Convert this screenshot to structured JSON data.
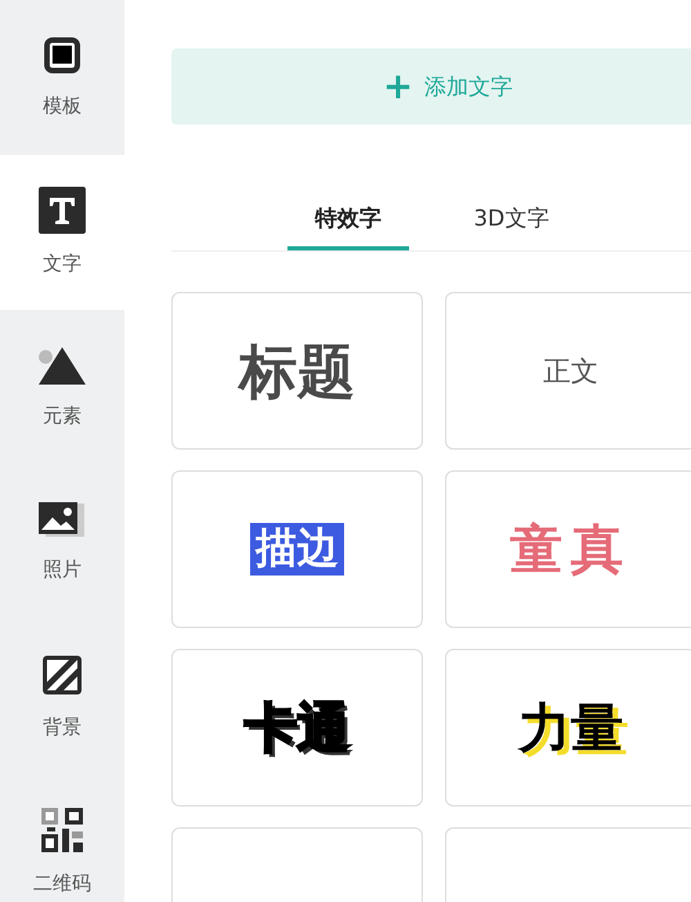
{
  "sidebar": {
    "items": [
      {
        "kind": "template",
        "label": "模板",
        "selected": false
      },
      {
        "kind": "text",
        "label": "文字",
        "selected": true
      },
      {
        "kind": "element",
        "label": "元素",
        "selected": false
      },
      {
        "kind": "photo",
        "label": "照片",
        "selected": false
      },
      {
        "kind": "background",
        "label": "背景",
        "selected": false
      },
      {
        "kind": "qrcode",
        "label": "二维码",
        "selected": false
      }
    ]
  },
  "add_text_button": {
    "icon": "+",
    "label": "添加文字"
  },
  "tabs": [
    {
      "label": "特效字",
      "selected": true
    },
    {
      "label": "3D文字",
      "selected": false
    }
  ],
  "styles": [
    {
      "kind": "title",
      "text": "标题"
    },
    {
      "kind": "body",
      "text": "正文"
    },
    {
      "kind": "outline",
      "text": "描边"
    },
    {
      "kind": "cute",
      "text": "童真"
    },
    {
      "kind": "cartoon",
      "text": "卡通"
    },
    {
      "kind": "power",
      "text": "力量"
    },
    {
      "kind": "partial"
    },
    {
      "kind": "partial"
    }
  ]
}
